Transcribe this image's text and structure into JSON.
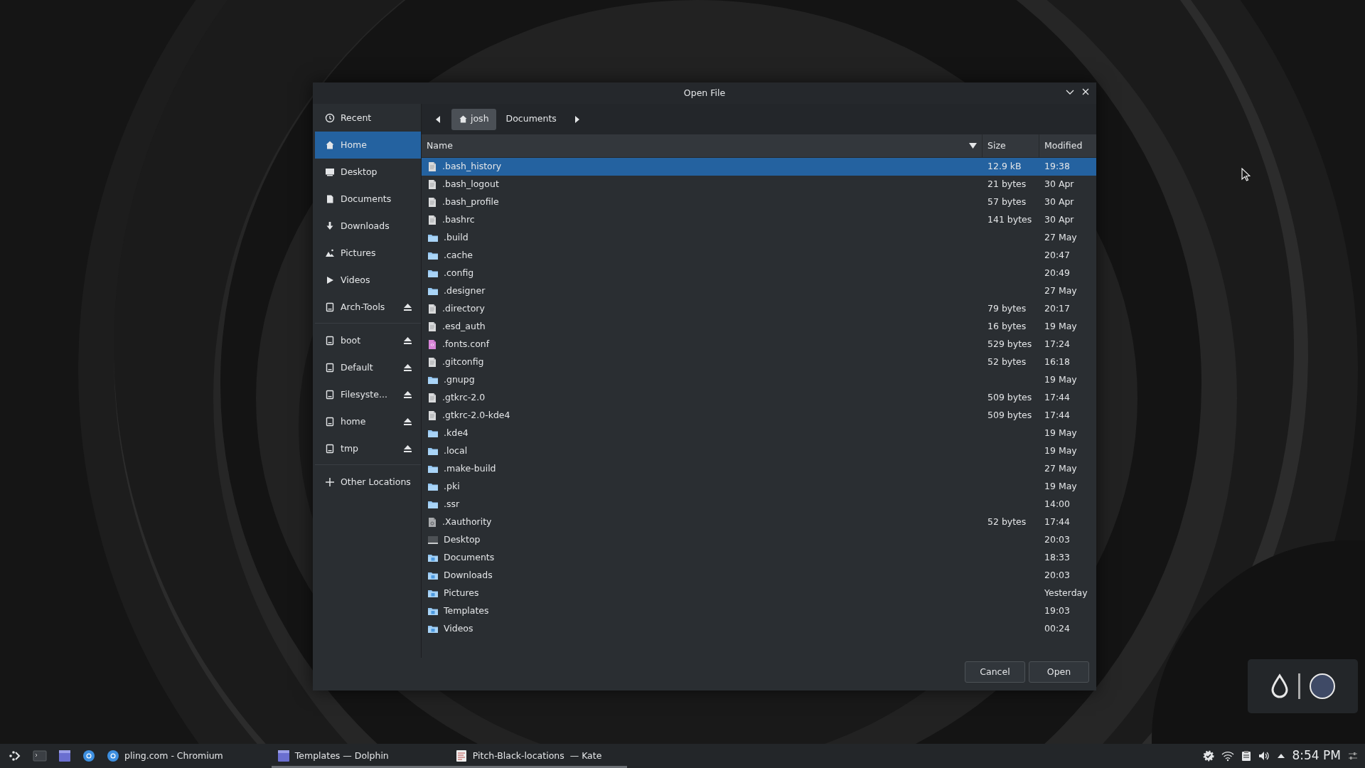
{
  "dialog": {
    "title": "Open File",
    "sidebar": [
      [
        {
          "kind": "recent",
          "label": "Recent",
          "selected": false,
          "eject": false
        },
        {
          "kind": "home",
          "label": "Home",
          "selected": true,
          "eject": false
        },
        {
          "kind": "desktop",
          "label": "Desktop",
          "selected": false,
          "eject": false
        },
        {
          "kind": "documents",
          "label": "Documents",
          "selected": false,
          "eject": false
        },
        {
          "kind": "downloads",
          "label": "Downloads",
          "selected": false,
          "eject": false
        },
        {
          "kind": "pictures",
          "label": "Pictures",
          "selected": false,
          "eject": false
        },
        {
          "kind": "videos",
          "label": "Videos",
          "selected": false,
          "eject": false
        },
        {
          "kind": "drive",
          "label": "Arch-Tools",
          "selected": false,
          "eject": true
        }
      ],
      [
        {
          "kind": "drive",
          "label": "boot",
          "selected": false,
          "eject": true
        },
        {
          "kind": "drive",
          "label": "Default",
          "selected": false,
          "eject": true
        },
        {
          "kind": "drive",
          "label": "Filesyste...",
          "selected": false,
          "eject": true
        },
        {
          "kind": "drive",
          "label": "home",
          "selected": false,
          "eject": true
        },
        {
          "kind": "drive",
          "label": "tmp",
          "selected": false,
          "eject": true
        }
      ],
      [
        {
          "kind": "add",
          "label": "Other Locations",
          "selected": false,
          "eject": false
        }
      ]
    ],
    "path": [
      {
        "kind": "home",
        "label": "josh",
        "selected": true
      },
      {
        "kind": "folder",
        "label": "Documents",
        "selected": false
      }
    ],
    "columns": [
      {
        "label": "Name",
        "sort_arrow": true
      },
      {
        "label": "Size",
        "sort_arrow": false
      },
      {
        "label": "Modified",
        "sort_arrow": false
      }
    ],
    "rows": [
      {
        "kind": "file",
        "name": ".bash_history",
        "size": "12.9 kB",
        "modified": "19:38",
        "selected": true
      },
      {
        "kind": "file",
        "name": ".bash_logout",
        "size": "21 bytes",
        "modified": "30 Apr",
        "selected": false
      },
      {
        "kind": "file",
        "name": ".bash_profile",
        "size": "57 bytes",
        "modified": "30 Apr",
        "selected": false
      },
      {
        "kind": "file",
        "name": ".bashrc",
        "size": "141 bytes",
        "modified": "30 Apr",
        "selected": false
      },
      {
        "kind": "folder",
        "name": ".build",
        "modified": "27 May",
        "selected": false
      },
      {
        "kind": "folder",
        "name": ".cache",
        "modified": "20:47",
        "selected": false
      },
      {
        "kind": "folder",
        "name": ".config",
        "modified": "20:49",
        "selected": false
      },
      {
        "kind": "folder",
        "name": ".designer",
        "modified": "27 May",
        "selected": false
      },
      {
        "kind": "file",
        "name": ".directory",
        "size": "79 bytes",
        "modified": "20:17",
        "selected": false
      },
      {
        "kind": "file",
        "name": ".esd_auth",
        "size": "16 bytes",
        "modified": "19 May",
        "selected": false
      },
      {
        "kind": "markup",
        "name": ".fonts.conf",
        "size": "529 bytes",
        "modified": "17:24",
        "selected": false
      },
      {
        "kind": "file",
        "name": ".gitconfig",
        "size": "52 bytes",
        "modified": "16:18",
        "selected": false
      },
      {
        "kind": "folder",
        "name": ".gnupg",
        "modified": "19 May",
        "selected": false
      },
      {
        "kind": "file",
        "name": ".gtkrc-2.0",
        "size": "509 bytes",
        "modified": "17:44",
        "selected": false
      },
      {
        "kind": "file",
        "name": ".gtkrc-2.0-kde4",
        "size": "509 bytes",
        "modified": "17:44",
        "selected": false
      },
      {
        "kind": "folder",
        "name": ".kde4",
        "modified": "19 May",
        "selected": false
      },
      {
        "kind": "folder",
        "name": ".local",
        "modified": "19 May",
        "selected": false
      },
      {
        "kind": "folder",
        "name": ".make-build",
        "modified": "27 May",
        "selected": false
      },
      {
        "kind": "folder",
        "name": ".pki",
        "modified": "19 May",
        "selected": false
      },
      {
        "kind": "folder",
        "name": ".ssr",
        "modified": "14:00",
        "selected": false
      },
      {
        "kind": "key",
        "name": ".Xauthority",
        "size": "52 bytes",
        "modified": "17:44",
        "selected": false
      },
      {
        "kind": "desktop",
        "name": "Desktop",
        "modified": "20:03",
        "selected": false
      },
      {
        "kind": "special",
        "name": "Documents",
        "modified": "18:33",
        "selected": false
      },
      {
        "kind": "special",
        "name": "Downloads",
        "modified": "20:03",
        "selected": false
      },
      {
        "kind": "special",
        "name": "Pictures",
        "modified": "Yesterday",
        "selected": false
      },
      {
        "kind": "special",
        "name": "Templates",
        "modified": "19:03",
        "selected": false
      },
      {
        "kind": "special",
        "name": "Videos",
        "modified": "00:24",
        "selected": false
      }
    ],
    "buttons": [
      "Cancel",
      "Open"
    ]
  },
  "taskbar": {
    "tasks": [
      {
        "kind": "browser",
        "label": "pling.com - Chromium",
        "underlined": false
      },
      {
        "kind": "files",
        "label": "Templates — Dolphin",
        "underlined": true
      },
      {
        "kind": "editor",
        "label": "Pitch-Black-locations  — Kate",
        "underlined": true
      }
    ],
    "clock": "8:54 PM"
  }
}
